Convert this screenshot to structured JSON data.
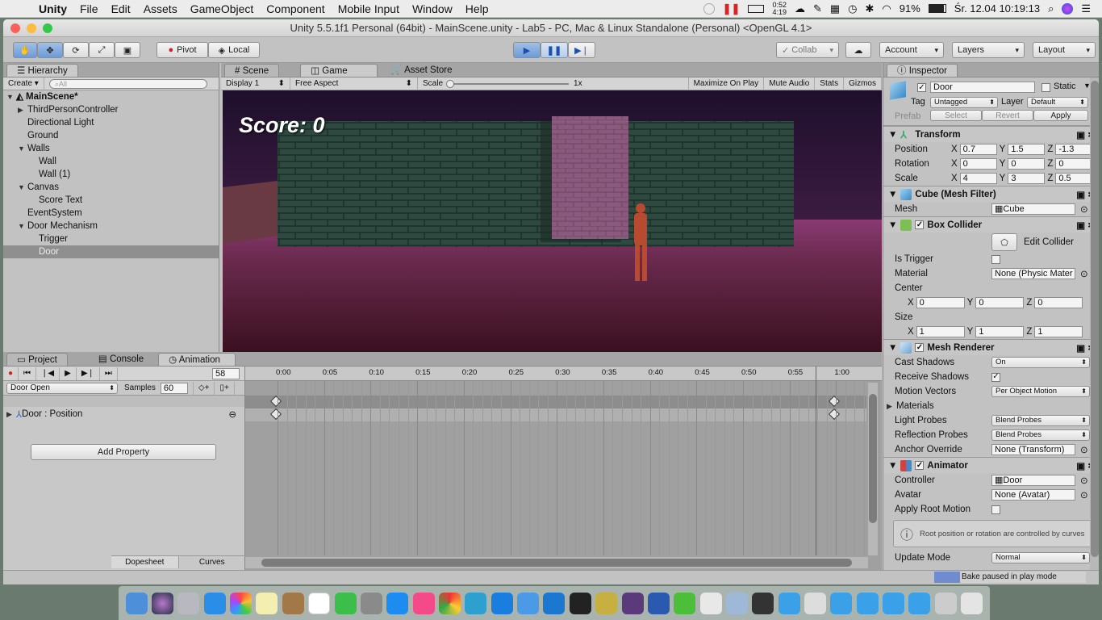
{
  "menubar": {
    "app": "Unity",
    "items": [
      "File",
      "Edit",
      "Assets",
      "GameObject",
      "Component",
      "Mobile Input",
      "Window",
      "Help"
    ],
    "timer_top": "0:52",
    "timer_bottom": "4:19",
    "battery": "91%",
    "datetime": "Śr. 12.04  10:19:13"
  },
  "window": {
    "title": "Unity 5.5.1f1 Personal (64bit) - MainScene.unity - Lab5 - PC, Mac & Linux Standalone (Personal) <OpenGL 4.1>"
  },
  "toolbar": {
    "pivot": "Pivot",
    "local": "Local",
    "collab": "Collab",
    "account": "Account",
    "layers": "Layers",
    "layout": "Layout"
  },
  "hierarchy": {
    "tab": "Hierarchy",
    "create": "Create",
    "search_placeholder": "All",
    "scene": "MainScene*",
    "items": [
      {
        "label": "ThirdPersonController",
        "indent": 1,
        "arrow": "▶"
      },
      {
        "label": "Directional Light",
        "indent": 1,
        "arrow": ""
      },
      {
        "label": "Ground",
        "indent": 1,
        "arrow": ""
      },
      {
        "label": "Walls",
        "indent": 1,
        "arrow": "▼"
      },
      {
        "label": "Wall",
        "indent": 2,
        "arrow": ""
      },
      {
        "label": "Wall (1)",
        "indent": 2,
        "arrow": ""
      },
      {
        "label": "Canvas",
        "indent": 1,
        "arrow": "▼"
      },
      {
        "label": "Score Text",
        "indent": 2,
        "arrow": ""
      },
      {
        "label": "EventSystem",
        "indent": 1,
        "arrow": ""
      },
      {
        "label": "Door Mechanism",
        "indent": 1,
        "arrow": "▼"
      },
      {
        "label": "Trigger",
        "indent": 2,
        "arrow": ""
      },
      {
        "label": "Door",
        "indent": 2,
        "arrow": "",
        "selected": true
      }
    ]
  },
  "tabs": {
    "scene": "Scene",
    "game": "Game",
    "store": "Asset Store"
  },
  "gamebar": {
    "display": "Display 1",
    "aspect": "Free Aspect",
    "scale": "Scale",
    "scale_val": "1x",
    "maximize": "Maximize On Play",
    "mute": "Mute Audio",
    "stats": "Stats",
    "gizmos": "Gizmos"
  },
  "game": {
    "score": "Score: 0"
  },
  "bottom_tabs": {
    "project": "Project",
    "console": "Console",
    "animation": "Animation"
  },
  "animation": {
    "frame": "58",
    "clip": "Door Open",
    "samples_label": "Samples",
    "samples": "60",
    "property": "Door : Position",
    "add_property": "Add Property",
    "dopesheet": "Dopesheet",
    "curves": "Curves",
    "ticks": [
      "0:00",
      "0:05",
      "0:10",
      "0:15",
      "0:20",
      "0:25",
      "0:30",
      "0:35",
      "0:40",
      "0:45",
      "0:50",
      "0:55",
      "1:00"
    ]
  },
  "inspector": {
    "tab": "Inspector",
    "name": "Door",
    "static": "Static",
    "tag_label": "Tag",
    "tag": "Untagged",
    "layer_label": "Layer",
    "layer": "Default",
    "prefab": "Prefab",
    "select": "Select",
    "revert": "Revert",
    "apply": "Apply",
    "transform": {
      "title": "Transform",
      "position": {
        "label": "Position",
        "x": "0.7",
        "y": "1.5",
        "z": "-1.3"
      },
      "rotation": {
        "label": "Rotation",
        "x": "0",
        "y": "0",
        "z": "0"
      },
      "scale": {
        "label": "Scale",
        "x": "4",
        "y": "3",
        "z": "0.5"
      }
    },
    "meshfilter": {
      "title": "Cube (Mesh Filter)",
      "mesh_label": "Mesh",
      "mesh": "Cube"
    },
    "collider": {
      "title": "Box Collider",
      "edit": "Edit Collider",
      "trigger": "Is Trigger",
      "material_label": "Material",
      "material": "None (Physic Mater",
      "center": "Center",
      "cx": "0",
      "cy": "0",
      "cz": "0",
      "size": "Size",
      "sx": "1",
      "sy": "1",
      "sz": "1"
    },
    "renderer": {
      "title": "Mesh Renderer",
      "cast_label": "Cast Shadows",
      "cast": "On",
      "receive": "Receive Shadows",
      "motion_label": "Motion Vectors",
      "motion": "Per Object Motion",
      "materials": "Materials",
      "light_label": "Light Probes",
      "light": "Blend Probes",
      "refl_label": "Reflection Probes",
      "refl": "Blend Probes",
      "anchor_label": "Anchor Override",
      "anchor": "None (Transform)"
    },
    "animator": {
      "title": "Animator",
      "controller_label": "Controller",
      "controller": "Door",
      "avatar_label": "Avatar",
      "avatar": "None (Avatar)",
      "root": "Apply Root Motion",
      "info": "Root position or rotation are controlled by curves",
      "update_label": "Update Mode",
      "update": "Normal"
    },
    "status": "Bake paused in play mode"
  },
  "axes": {
    "x": "X",
    "y": "Y",
    "z": "Z"
  },
  "colors": {
    "accent": "#3d7be0",
    "selection": "#8f8f8f",
    "playhead": "#e23030"
  }
}
